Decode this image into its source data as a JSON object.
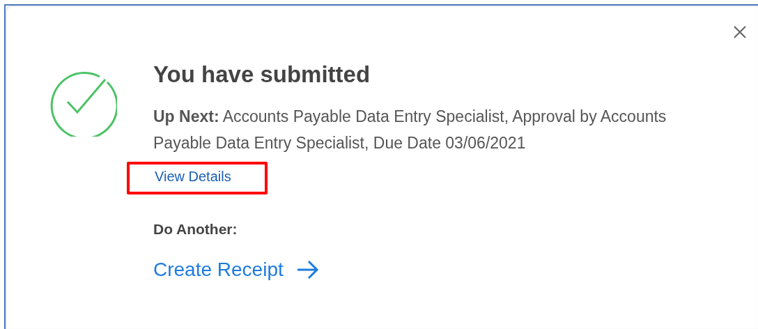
{
  "dialog": {
    "title": "You have submitted",
    "up_next": "**Up Next:** Accounts Payable Data Entry Specialist, Approval by Accounts Payable Data Entry Specialist, Due Date 03/06/2021",
    "view_details": {
      "label": "View Details",
      "highlighted": true
    },
    "do_another": "Do Another:",
    "action": {
      "label": "Create Receipt"
    }
  }
}
